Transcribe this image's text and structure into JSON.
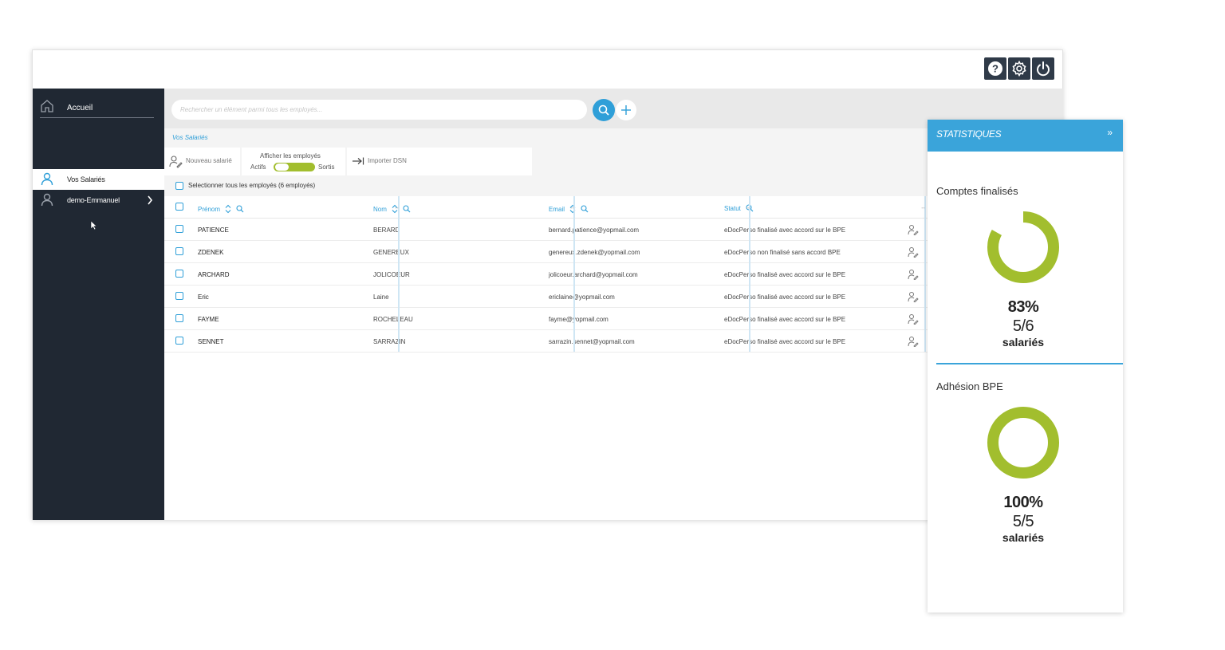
{
  "colors": {
    "sidebar_bg": "#202833",
    "accent_blue": "#2f9fd8",
    "stats_header": "#3aa4da",
    "donut_green": "#a2be2e"
  },
  "topbar": {
    "icons": [
      "help-icon",
      "settings-gear-icon",
      "power-icon"
    ]
  },
  "sidebar": {
    "home_label": "Accueil",
    "items": [
      {
        "label": "Vos Salariés",
        "active": true
      },
      {
        "label": "demo-Emmanuel",
        "active": false
      }
    ]
  },
  "search": {
    "placeholder": "Rechercher un élément parmi tous les employés..."
  },
  "breadcrumb": "Vos Salariés",
  "toolbar": {
    "new_label": "Nouveau salarié",
    "filter_title": "Afficher les employés",
    "filter_left": "Actifs",
    "filter_right": "Sortis",
    "import_label": "Importer DSN"
  },
  "select_all_label": "Selectionner tous les employés (6 employés)",
  "table": {
    "columns": [
      "Prénom",
      "Nom",
      "Email",
      "Statut"
    ],
    "rows": [
      {
        "prenom": "PATIENCE",
        "nom": "BERARD",
        "email": "bernard.patience@yopmail.com",
        "statut": "eDocPerso finalisé avec accord sur le BPE"
      },
      {
        "prenom": "ZDENEK",
        "nom": "GENEREUX",
        "email": "genereux.zdenek@yopmail.com",
        "statut": "eDocPerso non finalisé sans accord BPE"
      },
      {
        "prenom": "ARCHARD",
        "nom": "JOLICOEUR",
        "email": "jolicoeur.archard@yopmail.com",
        "statut": "eDocPerso finalisé avec accord sur le BPE"
      },
      {
        "prenom": "Eric",
        "nom": "Laine",
        "email": "ericlaine@yopmail.com",
        "statut": "eDocPerso finalisé avec accord sur le BPE"
      },
      {
        "prenom": "FAYME",
        "nom": "ROCHELEAU",
        "email": "fayme@yopmail.com",
        "statut": "eDocPerso finalisé avec accord sur le BPE"
      },
      {
        "prenom": "SENNET",
        "nom": "SARRAZIN",
        "email": "sarrazin.sennet@yopmail.com",
        "statut": "eDocPerso finalisé avec accord sur le BPE"
      }
    ]
  },
  "stats": {
    "title": "STATISTIQUES",
    "collapse_glyph": "»",
    "blocks": [
      {
        "title": "Comptes finalisés",
        "percent": "83%",
        "fraction": "5/6",
        "unit": "salariés",
        "ratio": 0.83
      },
      {
        "title": "Adhésion BPE",
        "percent": "100%",
        "fraction": "5/5",
        "unit": "salariés",
        "ratio": 1.0
      }
    ]
  }
}
